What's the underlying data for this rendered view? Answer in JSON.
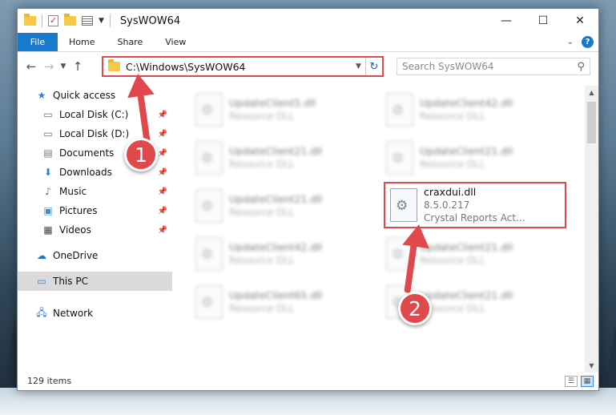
{
  "window": {
    "title": "SysWOW64"
  },
  "ribbon": {
    "tabs": [
      {
        "label": "File"
      },
      {
        "label": "Home"
      },
      {
        "label": "Share"
      },
      {
        "label": "View"
      }
    ]
  },
  "address": {
    "path": "C:\\Windows\\SysWOW64"
  },
  "search": {
    "placeholder": "Search SysWOW64"
  },
  "nav": {
    "quick_access": "Quick access",
    "items": [
      {
        "label": "Local Disk (C:)",
        "icon": "drive-icon"
      },
      {
        "label": "Local Disk (D:)",
        "icon": "drive-icon"
      },
      {
        "label": "Documents",
        "icon": "documents-icon"
      },
      {
        "label": "Downloads",
        "icon": "downloads-icon"
      },
      {
        "label": "Music",
        "icon": "music-icon"
      },
      {
        "label": "Pictures",
        "icon": "pictures-icon"
      },
      {
        "label": "Videos",
        "icon": "videos-icon"
      }
    ],
    "onedrive": "OneDrive",
    "this_pc": "This PC",
    "network": "Network"
  },
  "files": {
    "blurred": [
      {
        "name": "UpdateClient5.dll",
        "desc": "Resource DLL"
      },
      {
        "name": "UpdateClient42.dll",
        "desc": "Resource DLL"
      },
      {
        "name": "UpdateClient21.dll",
        "desc": "Resource DLL"
      },
      {
        "name": "UpdateClient21.dll",
        "desc": "Resource DLL"
      },
      {
        "name": "UpdateClient21.dll",
        "desc": "Resource DLL"
      },
      {
        "name": "UpdateClient42.dll",
        "desc": "Resource DLL"
      },
      {
        "name": "UpdateClient21.dll",
        "desc": "Resource DLL"
      },
      {
        "name": "UpdateClient65.dll",
        "desc": "Resource DLL"
      },
      {
        "name": "UpdateClient21.dll",
        "desc": "Resource DLL"
      }
    ],
    "highlighted": {
      "name": "craxdui.dll",
      "version": "8.5.0.217",
      "desc": "Crystal Reports Act..."
    }
  },
  "status": {
    "items_count": "129 items"
  },
  "annotations": {
    "step1": "1",
    "step2": "2",
    "color": "#e0494b"
  }
}
